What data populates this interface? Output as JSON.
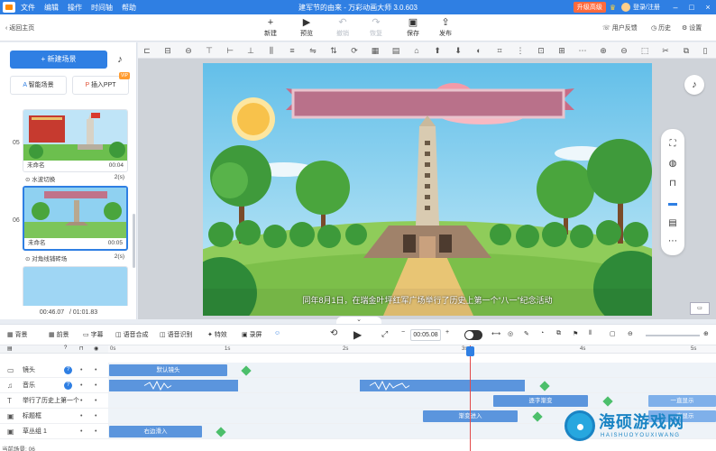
{
  "titlebar": {
    "menu": [
      "文件",
      "编辑",
      "操作",
      "时间轴",
      "帮助"
    ],
    "title": "建军节的由来 - 万彩动画大师 3.0.603",
    "upgrade": "升级高级",
    "login": "登录/注册"
  },
  "toolbar": {
    "back": "返回主页",
    "tools": [
      "新建",
      "预览",
      "撤销",
      "恢复",
      "保存",
      "发布"
    ],
    "right": [
      "用户反馈",
      "历史",
      "设置"
    ]
  },
  "left": {
    "new_scene": "新建场景",
    "smart_scene": "智能场景",
    "insert_ppt": "插入PPT",
    "vip": "VIP",
    "scenes": [
      {
        "no": "05",
        "name": "未命名",
        "time": "00:04",
        "transition": "水波切换",
        "duration": "2(s)"
      },
      {
        "no": "06",
        "name": "未命名",
        "time": "00:05",
        "transition": "对角线铺砖场",
        "duration": "2(s)"
      }
    ],
    "time_current": "00:46.07",
    "time_total": "/ 01:01.83"
  },
  "canvas": {
    "subtitle": "同年8月1日，在瑞金叶坪红军广场举行了历史上第一个“八一”纪念活动"
  },
  "timeline_toolbar": {
    "items": [
      "背景",
      "前景",
      "字幕",
      "语音合成",
      "语音识别",
      "特效",
      "录屏"
    ],
    "time": "00:05.08"
  },
  "timeline": {
    "ticks": [
      "0s",
      "1s",
      "2s",
      "3s",
      "4s",
      "5s"
    ],
    "tracks": [
      {
        "name": "镜头",
        "icon": "camera-icon",
        "clips": [
          {
            "label": "默认镜头"
          }
        ]
      },
      {
        "name": "音乐",
        "icon": "music-icon",
        "clips": []
      },
      {
        "name": "举行了历史上第一个",
        "icon": "text-icon",
        "clips": [
          {
            "label": "逐字渐变"
          },
          {
            "label": "一直显示"
          }
        ]
      },
      {
        "name": "标题框",
        "icon": "image-icon",
        "clips": [
          {
            "label": "渐变进入"
          },
          {
            "label": "一直显示"
          }
        ]
      },
      {
        "name": "草丛组 1",
        "icon": "image-icon",
        "clips": [
          {
            "label": "右边滑入"
          }
        ]
      }
    ],
    "bottom": "当前场景: 06"
  },
  "watermark": {
    "title": "海硕游戏网",
    "sub": "HAISHUOYOUXIWANG"
  },
  "colors": {
    "accent": "#2f7fe3",
    "clip": "#5b95dd",
    "keyframe": "#4cbf6b",
    "playhead": "#e24a4a"
  }
}
